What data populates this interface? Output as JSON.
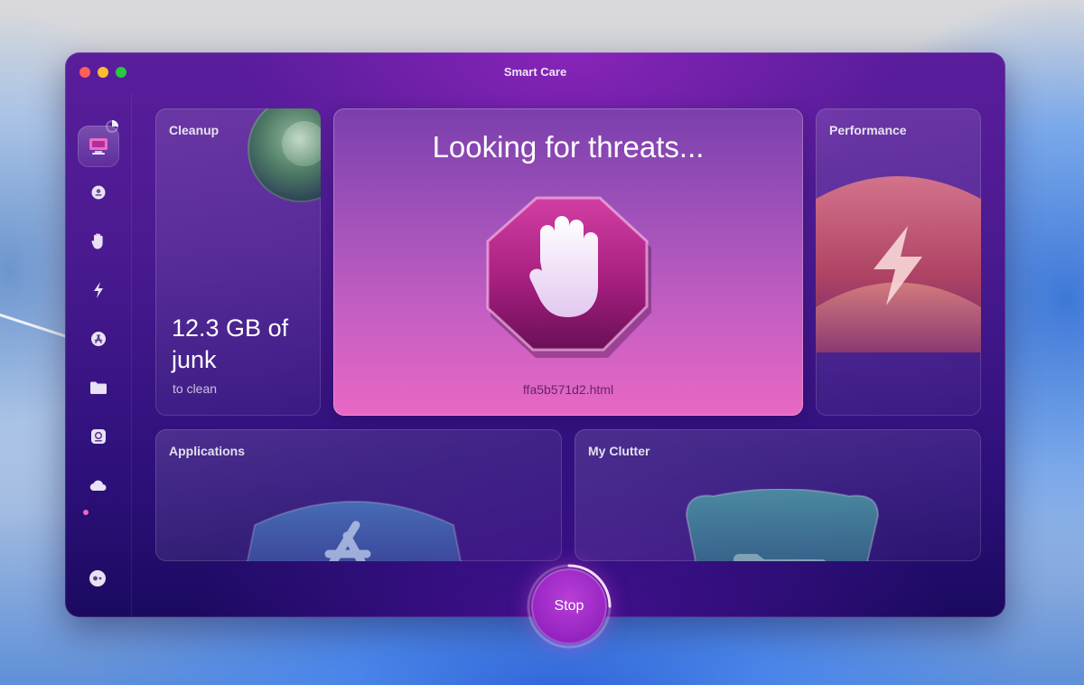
{
  "window": {
    "title": "Smart Care"
  },
  "sidebar": {
    "items": [
      {
        "icon": "smart-care-icon",
        "active": true
      },
      {
        "icon": "cleanup-icon"
      },
      {
        "icon": "protection-hand-icon"
      },
      {
        "icon": "performance-bolt-icon"
      },
      {
        "icon": "applications-icon"
      },
      {
        "icon": "my-clutter-folder-icon"
      },
      {
        "icon": "space-lens-icon"
      },
      {
        "icon": "cloud-cleanup-icon",
        "badge": true
      }
    ],
    "assistant_icon": "assistant-icon"
  },
  "cards": {
    "cleanup": {
      "label": "Cleanup",
      "value": "12.3 GB of junk",
      "sub": "to clean"
    },
    "protection": {
      "title": "Looking for threats...",
      "file": "ffa5b571d2.html",
      "icon": "stop-hand-icon"
    },
    "performance": {
      "label": "Performance"
    },
    "applications": {
      "label": "Applications"
    },
    "clutter": {
      "label": "My Clutter"
    }
  },
  "controls": {
    "stop_label": "Stop"
  },
  "colors": {
    "window_top": "#5a1d9c",
    "window_bottom": "#1b0a60",
    "threat_card_top": "#7a3fad",
    "threat_card_bottom": "#e868c4",
    "stop_button": "#9a27c4"
  }
}
